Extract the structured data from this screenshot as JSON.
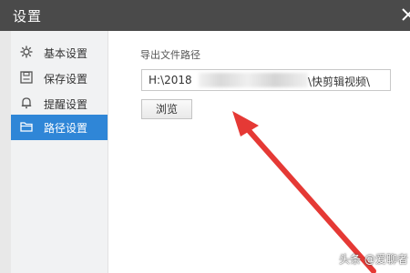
{
  "window": {
    "title": "设置"
  },
  "sidebar": {
    "items": [
      {
        "label": "基本设置",
        "icon": "gear-icon",
        "active": false
      },
      {
        "label": "保存设置",
        "icon": "save-icon",
        "active": false
      },
      {
        "label": "提醒设置",
        "icon": "bell-icon",
        "active": false
      },
      {
        "label": "路径设置",
        "icon": "folder-icon",
        "active": true
      }
    ]
  },
  "main": {
    "export_path_label": "导出文件路径",
    "export_path_visible_start": "H:\\2018",
    "export_path_visible_end": "\\快剪辑视频\\",
    "browse_label": "浏览"
  },
  "watermark": {
    "text": "头条 @爱聊者"
  },
  "colors": {
    "titlebar": "#4a4a4a",
    "sidebar_active": "#2f86d7",
    "annotation_arrow": "#e53935"
  }
}
